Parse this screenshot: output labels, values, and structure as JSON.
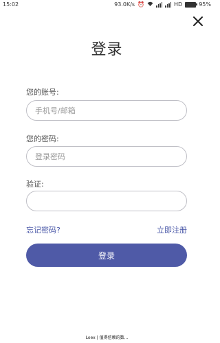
{
  "status_bar": {
    "time": "15:02",
    "network_speed": "93.0K/s",
    "network_type": "HD",
    "battery": "95%",
    "battery_level": 0.95
  },
  "header": {
    "title": "登录",
    "close_icon": "close-icon"
  },
  "form": {
    "account_label": "您的账号:",
    "account_placeholder": "手机号/邮箱",
    "password_label": "您的密码:",
    "password_placeholder": "登录密码",
    "captcha_label": "验证:",
    "captcha_value": ""
  },
  "links": {
    "forgot_password": "忘记密码?",
    "register": "立即注册"
  },
  "actions": {
    "login_button": "登录"
  },
  "footer": {
    "watermark": "Loex | 值得信赖的数..."
  },
  "colors": {
    "accent": "#4f5aa7",
    "link": "#4a58a8",
    "field_border": "#bfbfc6"
  }
}
